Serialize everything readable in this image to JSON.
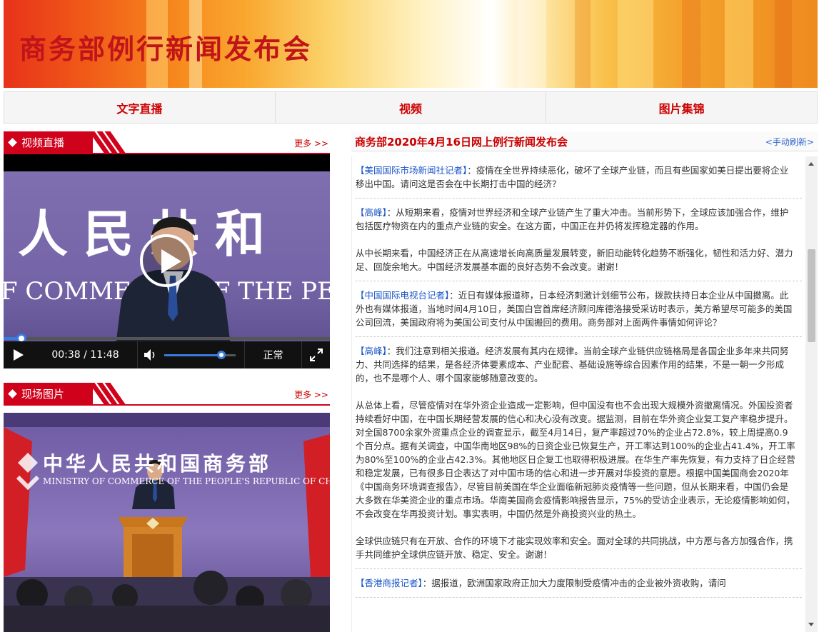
{
  "banner": {
    "title": "商务部例行新闻发布会"
  },
  "nav": {
    "tabs": [
      "文字直播",
      "视频",
      "图片集锦"
    ]
  },
  "video_section": {
    "label": "视频直播",
    "more": "更多 >>",
    "backdrop_text": "人民共和",
    "backdrop_sub": "F COMMERCE OF THE PEOPLE",
    "time": "00:38 / 11:48",
    "speed": "正常",
    "progress_fraction": 0.054,
    "volume_fraction": 0.8
  },
  "photo_section": {
    "label": "现场图片",
    "more": "更多 >>",
    "backdrop_title": "中华人民共和国商务部",
    "backdrop_sub": "MINISTRY OF COMMERCE OF THE PEOPLE'S REPUBLIC OF CHINA"
  },
  "live": {
    "title": "商务部2020年4月16日网上例行新闻发布会",
    "refresh": "<手动刷新>",
    "entries": [
      {
        "speaker": "【美国国际市场新闻社记者】",
        "paragraphs": [
          "：疫情在全世界持续恶化，破坏了全球产业链，而且有些国家如美日提出要将企业移出中国。请问这是否会在中长期打击中国的经济？"
        ]
      },
      {
        "speaker": "【高峰】",
        "paragraphs": [
          "：从短期来看，疫情对世界经济和全球产业链产生了重大冲击。当前形势下，全球应该加强合作，维护包括医疗物资在内的重点产业链的安全。在这方面，中国正在并仍将发挥稳定器的作用。",
          "从中长期来看，中国经济正在从高速增长向高质量发展转变，新旧动能转化趋势不断强化，韧性和活力好、潜力足、回旋余地大。中国经济发展基本面的良好态势不会改变。谢谢！"
        ]
      },
      {
        "speaker": "【中国国际电视台记者】",
        "paragraphs": [
          "：近日有媒体报道称，日本经济刺激计划细节公布，拨款扶持日本企业从中国撤离。此外也有媒体报道，当地时间4月10日，美国白宫首席经济顾问库德洛接受采访时表示，美方希望尽可能多的美国公司回流，美国政府将为美国公司支付从中国搬回的费用。商务部对上面两件事情如何评论？"
        ]
      },
      {
        "speaker": "【高峰】",
        "paragraphs": [
          "：我们注意到相关报道。经济发展有其内在规律。当前全球产业链供应链格局是各国企业多年来共同努力、共同选择的结果，是各经济体要素成本、产业配套、基础设施等综合因素作用的结果，不是一朝一夕形成的，也不是哪个人、哪个国家能够随意改变的。",
          "从总体上看，尽管疫情对在华外资企业造成一定影响，但中国没有也不会出现大规模外资撤离情况。外国投资者持续看好中国，在中国长期经营发展的信心和决心没有改变。据监测，目前在华外资企业复工复产率稳步提升。对全国8700余家外资重点企业的调查显示，截至4月14日，复产率超过70%的企业占72.8%，较上周提高0.9个百分点。据有关调查，中国华南地区98%的日资企业已恢复生产，开工率达到100%的企业占41.4%，开工率为80%至100%的企业占42.3%。其他地区日企复工也取得积极进展。在华生产率先恢复，有力支持了日企经营和稳定发展，已有很多日企表达了对中国市场的信心和进一步开展对华投资的意愿。根据中国美国商会2020年《中国商务环境调查报告》，尽管目前美国在华企业面临新冠肺炎疫情等一些问题，但从长期来看，中国仍会是大多数在华美资企业的重点市场。华南美国商会疫情影响报告显示，75%的受访企业表示，无论疫情影响如何，不会改变在华再投资计划。事实表明，中国仍然是外商投资兴业的热土。",
          "全球供应链只有在开放、合作的环境下才能实现效率和安全。面对全球的共同挑战，中方愿与各方加强合作，携手共同维护全球供应链开放、稳定、安全。谢谢！"
        ]
      },
      {
        "speaker": "【香港商报记者】",
        "paragraphs": [
          "：据报道，欧洲国家政府正加大力度限制受疫情冲击的企业被外资收购，请问"
        ]
      }
    ]
  }
}
